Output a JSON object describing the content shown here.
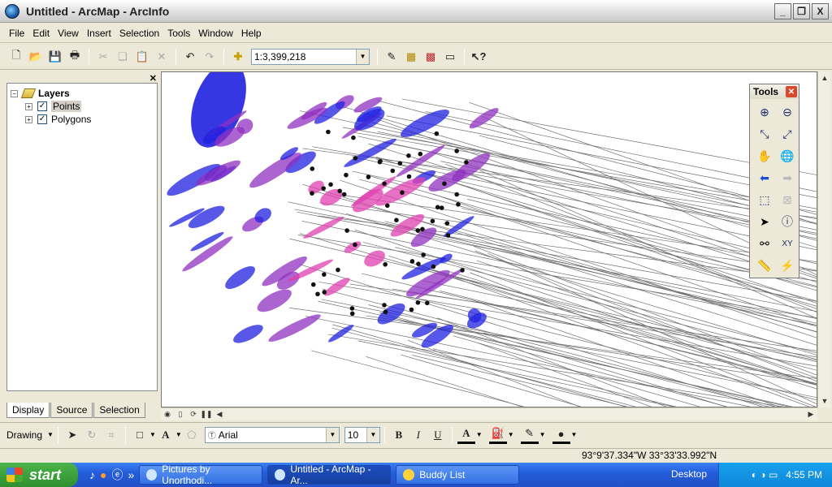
{
  "window": {
    "title": "Untitled - ArcMap - ArcInfo",
    "min_label": "_",
    "max_label": "□",
    "close_label": "X"
  },
  "menu": [
    "File",
    "Edit",
    "View",
    "Insert",
    "Selection",
    "Tools",
    "Window",
    "Help"
  ],
  "toolbar": {
    "scale": "1:3,399,218"
  },
  "toc": {
    "root_label": "Layers",
    "layers": [
      {
        "label": "Points",
        "checked": true
      },
      {
        "label": "Polygons",
        "checked": true
      }
    ],
    "tabs": [
      "Display",
      "Source",
      "Selection"
    ]
  },
  "tools_palette": {
    "title": "Tools"
  },
  "drawing": {
    "label": "Drawing",
    "font": "Arial",
    "size": "10",
    "bold": "B",
    "italic": "I",
    "underline": "U",
    "text_tool": "A"
  },
  "status": {
    "coords": "93°9'37.334\"W  33°33'33.992\"N"
  },
  "taskbar": {
    "start": "start",
    "tasks": [
      {
        "label": "Pictures by Unorthodi..."
      },
      {
        "label": "Untitled - ArcMap - Ar..."
      },
      {
        "label": "Buddy List"
      }
    ],
    "desktop": "Desktop",
    "time": "4:55 PM"
  },
  "colors": {
    "blue": "#2020e0",
    "purple": "#9030c0",
    "magenta": "#e040b0",
    "lines": "#707070"
  }
}
